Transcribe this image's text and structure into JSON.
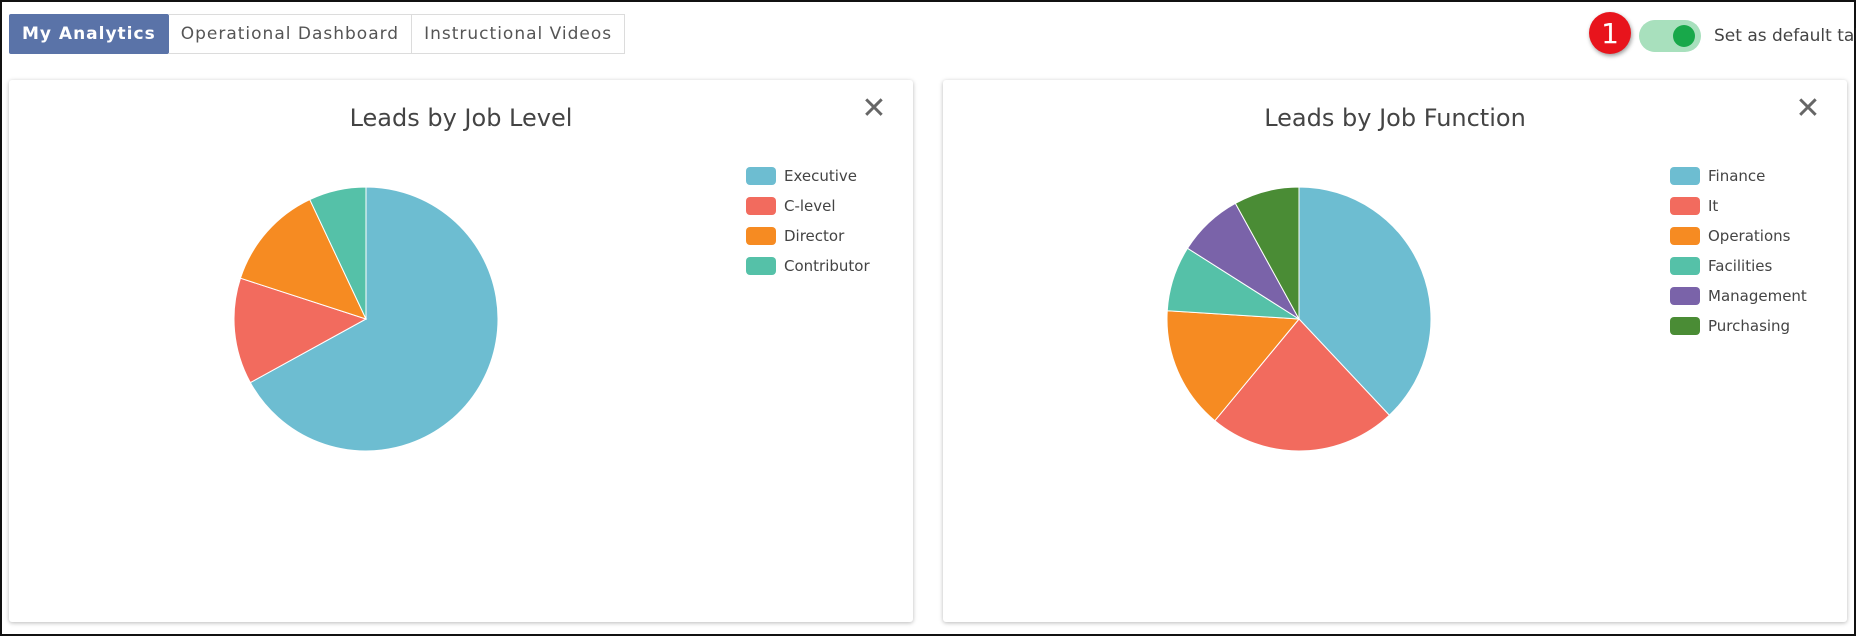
{
  "tabs": [
    {
      "label": "My Analytics",
      "active": true
    },
    {
      "label": "Operational Dashboard",
      "active": false
    },
    {
      "label": "Instructional Videos",
      "active": false
    }
  ],
  "annotation_badge": "1",
  "default_toggle": {
    "label": "Set as default tab",
    "on": true,
    "on_color": "#18a84a"
  },
  "close_glyph": "✕",
  "colors": {
    "blue": "#6dbdd1",
    "red": "#f26b5e",
    "orange": "#f68b22",
    "teal": "#55c1a8",
    "purple": "#7a63a9",
    "green": "#4a8c35"
  },
  "chart_data": [
    {
      "type": "pie",
      "title": "Leads by Job Level",
      "legend_position": "top-right",
      "series": [
        {
          "name": "Executive",
          "value": 67,
          "color": "#6dbdd1"
        },
        {
          "name": "C-level",
          "value": 13,
          "color": "#f26b5e"
        },
        {
          "name": "Director",
          "value": 13,
          "color": "#f68b22"
        },
        {
          "name": "Contributor",
          "value": 7,
          "color": "#55c1a8"
        }
      ]
    },
    {
      "type": "pie",
      "title": "Leads by Job Function",
      "legend_position": "top-right",
      "series": [
        {
          "name": "Finance",
          "value": 38,
          "color": "#6dbdd1"
        },
        {
          "name": "It",
          "value": 23,
          "color": "#f26b5e"
        },
        {
          "name": "Operations",
          "value": 15,
          "color": "#f68b22"
        },
        {
          "name": "Facilities",
          "value": 8,
          "color": "#55c1a8"
        },
        {
          "name": "Management",
          "value": 8,
          "color": "#7a63a9"
        },
        {
          "name": "Purchasing",
          "value": 8,
          "color": "#4a8c35"
        }
      ]
    }
  ]
}
